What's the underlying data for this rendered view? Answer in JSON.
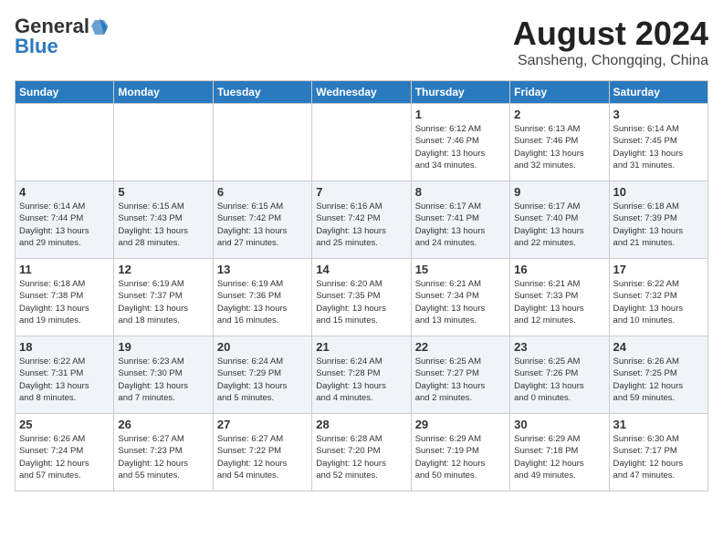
{
  "header": {
    "logo_general": "General",
    "logo_blue": "Blue",
    "month_year": "August 2024",
    "location": "Sansheng, Chongqing, China"
  },
  "weekdays": [
    "Sunday",
    "Monday",
    "Tuesday",
    "Wednesday",
    "Thursday",
    "Friday",
    "Saturday"
  ],
  "weeks": [
    [
      {
        "day": "",
        "info": ""
      },
      {
        "day": "",
        "info": ""
      },
      {
        "day": "",
        "info": ""
      },
      {
        "day": "",
        "info": ""
      },
      {
        "day": "1",
        "info": "Sunrise: 6:12 AM\nSunset: 7:46 PM\nDaylight: 13 hours\nand 34 minutes."
      },
      {
        "day": "2",
        "info": "Sunrise: 6:13 AM\nSunset: 7:46 PM\nDaylight: 13 hours\nand 32 minutes."
      },
      {
        "day": "3",
        "info": "Sunrise: 6:14 AM\nSunset: 7:45 PM\nDaylight: 13 hours\nand 31 minutes."
      }
    ],
    [
      {
        "day": "4",
        "info": "Sunrise: 6:14 AM\nSunset: 7:44 PM\nDaylight: 13 hours\nand 29 minutes."
      },
      {
        "day": "5",
        "info": "Sunrise: 6:15 AM\nSunset: 7:43 PM\nDaylight: 13 hours\nand 28 minutes."
      },
      {
        "day": "6",
        "info": "Sunrise: 6:15 AM\nSunset: 7:42 PM\nDaylight: 13 hours\nand 27 minutes."
      },
      {
        "day": "7",
        "info": "Sunrise: 6:16 AM\nSunset: 7:42 PM\nDaylight: 13 hours\nand 25 minutes."
      },
      {
        "day": "8",
        "info": "Sunrise: 6:17 AM\nSunset: 7:41 PM\nDaylight: 13 hours\nand 24 minutes."
      },
      {
        "day": "9",
        "info": "Sunrise: 6:17 AM\nSunset: 7:40 PM\nDaylight: 13 hours\nand 22 minutes."
      },
      {
        "day": "10",
        "info": "Sunrise: 6:18 AM\nSunset: 7:39 PM\nDaylight: 13 hours\nand 21 minutes."
      }
    ],
    [
      {
        "day": "11",
        "info": "Sunrise: 6:18 AM\nSunset: 7:38 PM\nDaylight: 13 hours\nand 19 minutes."
      },
      {
        "day": "12",
        "info": "Sunrise: 6:19 AM\nSunset: 7:37 PM\nDaylight: 13 hours\nand 18 minutes."
      },
      {
        "day": "13",
        "info": "Sunrise: 6:19 AM\nSunset: 7:36 PM\nDaylight: 13 hours\nand 16 minutes."
      },
      {
        "day": "14",
        "info": "Sunrise: 6:20 AM\nSunset: 7:35 PM\nDaylight: 13 hours\nand 15 minutes."
      },
      {
        "day": "15",
        "info": "Sunrise: 6:21 AM\nSunset: 7:34 PM\nDaylight: 13 hours\nand 13 minutes."
      },
      {
        "day": "16",
        "info": "Sunrise: 6:21 AM\nSunset: 7:33 PM\nDaylight: 13 hours\nand 12 minutes."
      },
      {
        "day": "17",
        "info": "Sunrise: 6:22 AM\nSunset: 7:32 PM\nDaylight: 13 hours\nand 10 minutes."
      }
    ],
    [
      {
        "day": "18",
        "info": "Sunrise: 6:22 AM\nSunset: 7:31 PM\nDaylight: 13 hours\nand 8 minutes."
      },
      {
        "day": "19",
        "info": "Sunrise: 6:23 AM\nSunset: 7:30 PM\nDaylight: 13 hours\nand 7 minutes."
      },
      {
        "day": "20",
        "info": "Sunrise: 6:24 AM\nSunset: 7:29 PM\nDaylight: 13 hours\nand 5 minutes."
      },
      {
        "day": "21",
        "info": "Sunrise: 6:24 AM\nSunset: 7:28 PM\nDaylight: 13 hours\nand 4 minutes."
      },
      {
        "day": "22",
        "info": "Sunrise: 6:25 AM\nSunset: 7:27 PM\nDaylight: 13 hours\nand 2 minutes."
      },
      {
        "day": "23",
        "info": "Sunrise: 6:25 AM\nSunset: 7:26 PM\nDaylight: 13 hours\nand 0 minutes."
      },
      {
        "day": "24",
        "info": "Sunrise: 6:26 AM\nSunset: 7:25 PM\nDaylight: 12 hours\nand 59 minutes."
      }
    ],
    [
      {
        "day": "25",
        "info": "Sunrise: 6:26 AM\nSunset: 7:24 PM\nDaylight: 12 hours\nand 57 minutes."
      },
      {
        "day": "26",
        "info": "Sunrise: 6:27 AM\nSunset: 7:23 PM\nDaylight: 12 hours\nand 55 minutes."
      },
      {
        "day": "27",
        "info": "Sunrise: 6:27 AM\nSunset: 7:22 PM\nDaylight: 12 hours\nand 54 minutes."
      },
      {
        "day": "28",
        "info": "Sunrise: 6:28 AM\nSunset: 7:20 PM\nDaylight: 12 hours\nand 52 minutes."
      },
      {
        "day": "29",
        "info": "Sunrise: 6:29 AM\nSunset: 7:19 PM\nDaylight: 12 hours\nand 50 minutes."
      },
      {
        "day": "30",
        "info": "Sunrise: 6:29 AM\nSunset: 7:18 PM\nDaylight: 12 hours\nand 49 minutes."
      },
      {
        "day": "31",
        "info": "Sunrise: 6:30 AM\nSunset: 7:17 PM\nDaylight: 12 hours\nand 47 minutes."
      }
    ]
  ]
}
